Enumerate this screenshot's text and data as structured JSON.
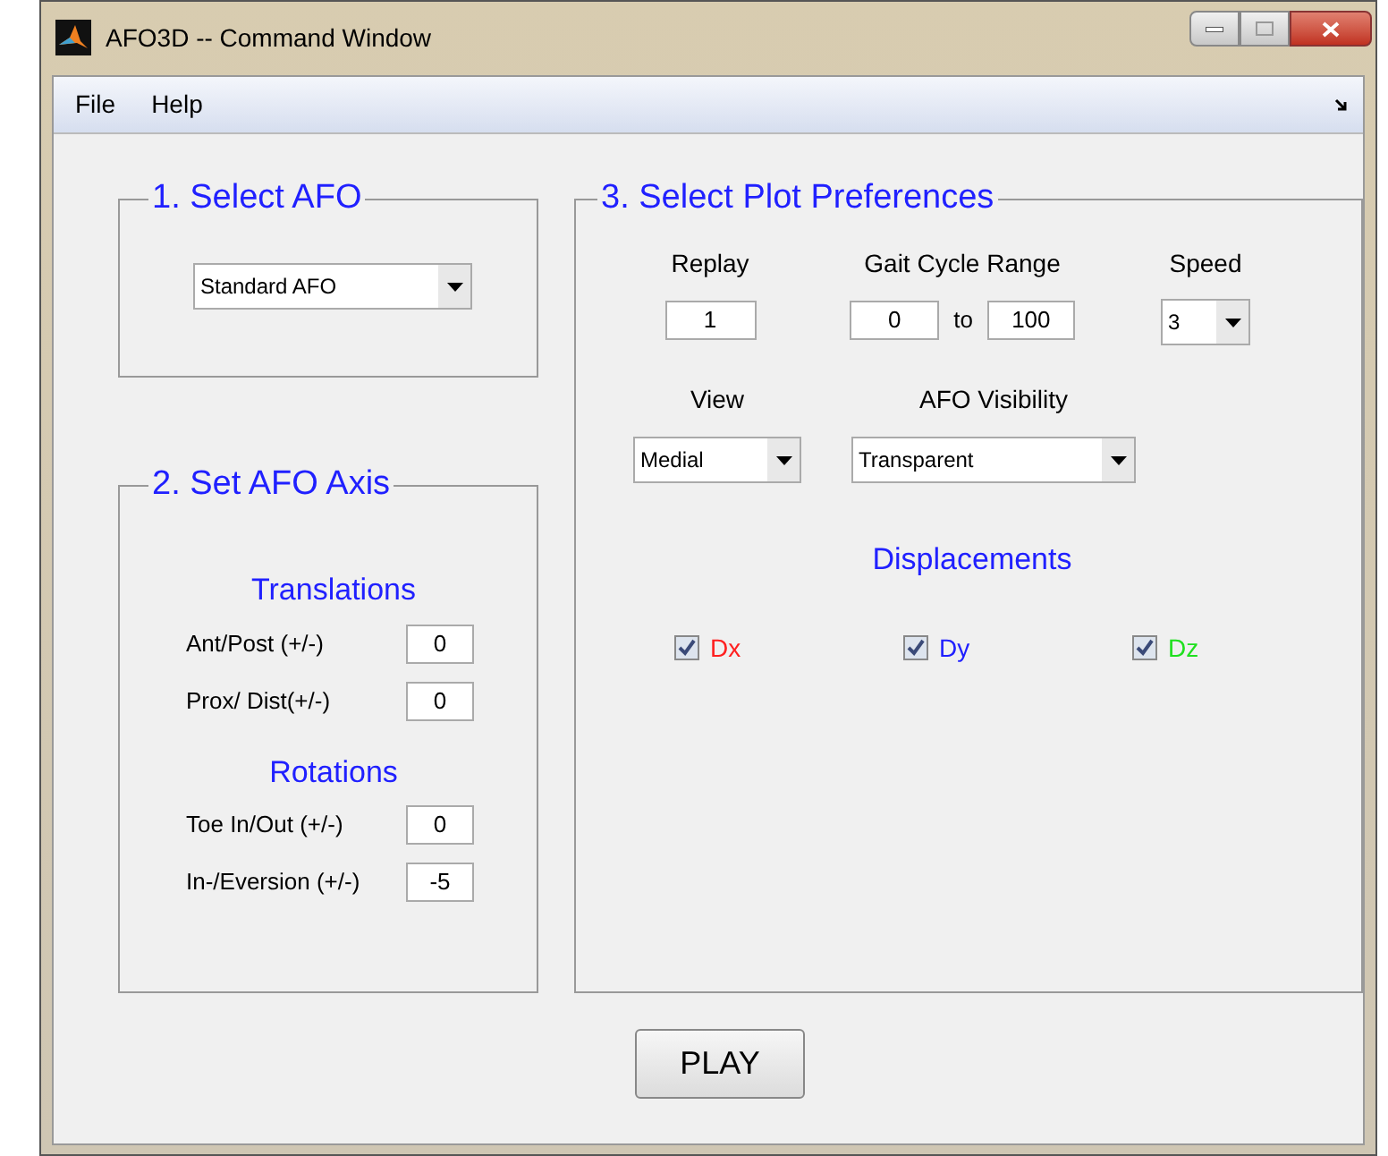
{
  "window": {
    "title": "AFO3D -- Command Window"
  },
  "menu": [
    {
      "label": "File"
    },
    {
      "label": "Help"
    }
  ],
  "select_afo": {
    "title": "1. Select AFO",
    "dropdown": {
      "value": "Standard AFO"
    }
  },
  "axis": {
    "title": "2. Set AFO Axis",
    "groups": [
      {
        "heading": "Translations",
        "fields": [
          {
            "label": "Ant/Post (+/-)",
            "value": "0"
          },
          {
            "label": "Prox/ Dist(+/-)",
            "value": "0"
          }
        ]
      },
      {
        "heading": "Rotations",
        "fields": [
          {
            "label": "Toe In/Out (+/-)",
            "value": "0"
          },
          {
            "label": "In-/Eversion (+/-)",
            "value": "-5"
          }
        ]
      }
    ]
  },
  "plot": {
    "title": "3. Select Plot Preferences",
    "replay": {
      "label": "Replay",
      "value": "1"
    },
    "gait": {
      "label": "Gait Cycle Range",
      "from": "0",
      "to_label": "to",
      "to": "100"
    },
    "speed": {
      "label": "Speed",
      "value": "3"
    },
    "view": {
      "label": "View",
      "value": "Medial"
    },
    "visibility": {
      "label": "AFO Visibility",
      "value": "Transparent"
    },
    "displacements": {
      "heading": "Displacements",
      "checkboxes": [
        {
          "label": "Dx",
          "checked": true,
          "color": "#ff2020"
        },
        {
          "label": "Dy",
          "checked": true,
          "color": "#2020ff"
        },
        {
          "label": "Dz",
          "checked": true,
          "color": "#20e020"
        }
      ]
    }
  },
  "play_button": {
    "label": "PLAY"
  }
}
